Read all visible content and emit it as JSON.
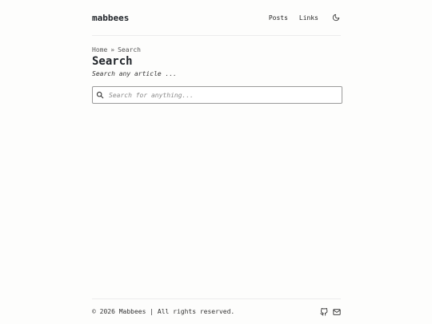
{
  "header": {
    "logo": "mabbees",
    "nav": [
      {
        "label": "Posts"
      },
      {
        "label": "Links"
      }
    ],
    "theme_toggle_icon": "moon-icon"
  },
  "breadcrumb": {
    "home": "Home",
    "separator": "»",
    "current": "Search"
  },
  "page": {
    "title": "Search",
    "subtitle": "Search any article ..."
  },
  "search": {
    "placeholder": "Search for anything...",
    "value": "",
    "icon": "search-icon"
  },
  "footer": {
    "copyright": "© 2026 Mabbees | All rights reserved.",
    "social_icons": [
      "github-icon",
      "mail-icon"
    ]
  }
}
